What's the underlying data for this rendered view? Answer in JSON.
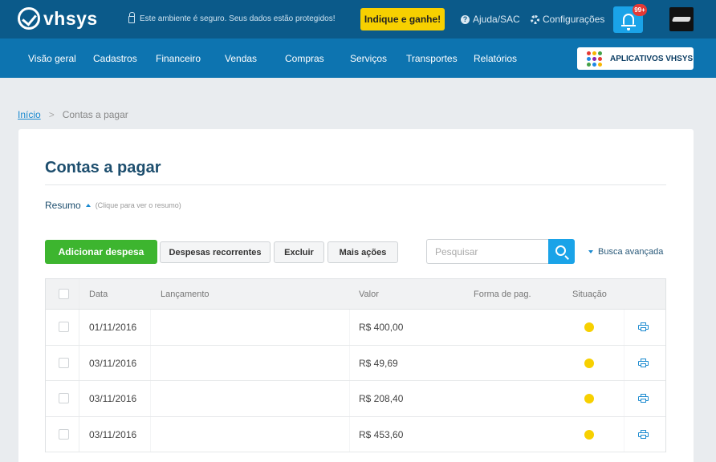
{
  "topbar": {
    "logo": "vhsys",
    "secure_text": "Este ambiente é seguro. Seus dados estão protegidos!",
    "indique_label": "Indique e ganhe!",
    "help_label": "Ajuda/SAC",
    "config_label": "Configurações",
    "notifications_badge": "99+"
  },
  "nav": {
    "items": [
      "Visão geral",
      "Cadastros",
      "Financeiro",
      "Vendas",
      "Compras",
      "Serviços",
      "Transportes",
      "Relatórios"
    ],
    "apps_label": "APLICATIVOS VHSYS",
    "apps_colors": [
      "#e53935",
      "#f7b500",
      "#43a047",
      "#1e88e5",
      "#8e24aa",
      "#e53935",
      "#43a047",
      "#1e88e5",
      "#f7b500"
    ]
  },
  "breadcrumb": {
    "home": "Início",
    "separator": ">",
    "current": "Contas a pagar"
  },
  "page": {
    "title": "Contas a pagar",
    "resumo_label": "Resumo",
    "resumo_hint": "(Clique para ver o resumo)"
  },
  "toolbar": {
    "add_label": "Adicionar despesa",
    "recurring_label": "Despesas recorrentes",
    "delete_label": "Excluir",
    "more_label": "Mais ações",
    "search_placeholder": "Pesquisar",
    "advanced_label": "Busca avançada"
  },
  "table": {
    "headers": [
      "Data",
      "Lançamento",
      "Valor",
      "Forma de pag.",
      "Situação"
    ],
    "rows": [
      {
        "date": "01/11/2016",
        "lancamento": "",
        "valor": "R$ 400,00",
        "forma": "",
        "status_color": "#f7d000"
      },
      {
        "date": "03/11/2016",
        "lancamento": "",
        "valor": "R$ 49,69",
        "forma": "",
        "status_color": "#f7d000"
      },
      {
        "date": "03/11/2016",
        "lancamento": "",
        "valor": "R$ 208,40",
        "forma": "",
        "status_color": "#f7d000"
      },
      {
        "date": "03/11/2016",
        "lancamento": "",
        "valor": "R$ 453,60",
        "forma": "",
        "status_color": "#f7d000"
      }
    ]
  },
  "colors": {
    "topbar": "#0b5a8a",
    "navbar": "#0d74b0",
    "primary_button": "#3db52f",
    "accent": "#1aa3e8",
    "status_pending": "#f7d000"
  }
}
